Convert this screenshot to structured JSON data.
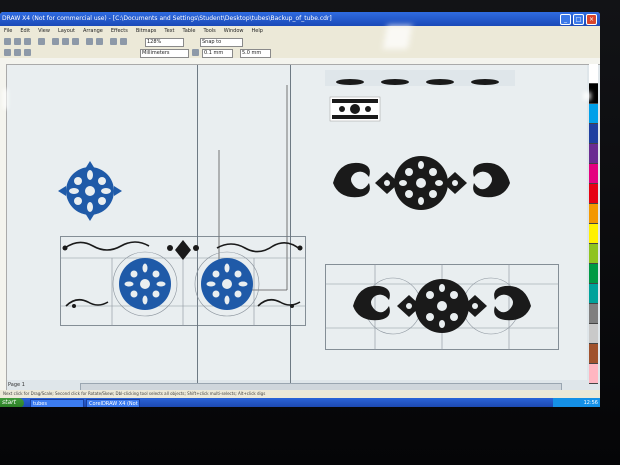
{
  "window": {
    "title": "DRAW X4 (Not for commercial use) - [C:\\Documents and Settings\\Student\\Desktop\\tubes\\Backup_of_tube.cdr]"
  },
  "menu": [
    "File",
    "Edit",
    "View",
    "Layout",
    "Arrange",
    "Effects",
    "Bitmaps",
    "Text",
    "Table",
    "Tools",
    "Window",
    "Help"
  ],
  "toolbar": {
    "zoom": "128%",
    "snap": "Snap to",
    "units": "Millimeters",
    "nudge": "0.1 mm",
    "duplicate": "5.0 mm"
  },
  "statusbar": {
    "text": "Next click for Drag/Scale; Second click for Rotate/Skew; Dbl-clicking tool selects all objects; Shift+click multi-selects; Alt+click digs"
  },
  "page_nav": {
    "label": "Page 1"
  },
  "taskbar": {
    "start_label": "start",
    "tasks": [
      "tubes",
      "CorelDRAW X4 (Not f..."
    ],
    "clock": "12:56"
  },
  "colors": {
    "ornament_blue": "#1f5aa8",
    "ornament_black": "#1a1a1a",
    "title_blue": "#2057c8",
    "palette": [
      "#ffffff",
      "#000000",
      "#00a0e9",
      "#1e3fa0",
      "#6a2c91",
      "#e4007f",
      "#e60012",
      "#f39800",
      "#fff100",
      "#8fc31f",
      "#009944",
      "#00a29a",
      "#7f7f7f",
      "#c9c9c9",
      "#a0522d",
      "#ffb6c1"
    ]
  }
}
